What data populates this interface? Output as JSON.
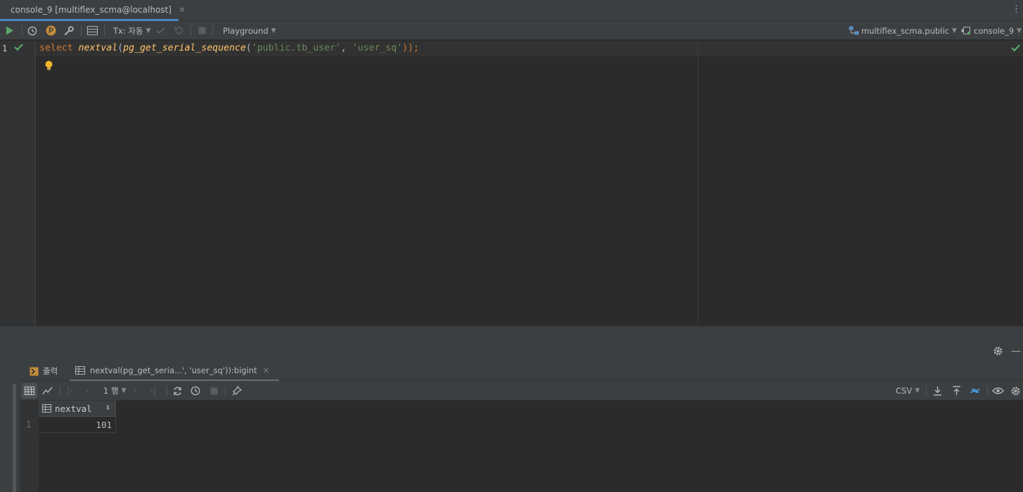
{
  "tab": {
    "title": "console_9 [multiflex_scma@localhost]"
  },
  "toolbar": {
    "tx_label": "Tx: 자동",
    "playground_label": "Playground",
    "schema_label": "multiflex_scma.public",
    "session_label": "console_9"
  },
  "editor": {
    "line_number": "1",
    "code": {
      "keyword": "select",
      "space": " ",
      "func1": "nextval",
      "paren_open": "(",
      "func2": "pg_get_serial_sequence",
      "paren_open2": "(",
      "arg1": "'public.tb_user'",
      "comma": ", ",
      "arg2": "'user_sq'",
      "close": "));"
    }
  },
  "results": {
    "output_tab_label": "출력",
    "result_tab_label": "nextval(pg_get_seria...', 'user_sq')):bigint",
    "row_count_label": "1 행",
    "export_format": "CSV",
    "columns": [
      "nextval"
    ],
    "rows": [
      {
        "row_number": "1",
        "values": [
          "101"
        ]
      }
    ]
  },
  "colors": {
    "accent": "#4a88c7",
    "success": "#59a869",
    "keyword": "#cc7832",
    "function": "#ffc66d",
    "string": "#6a8759",
    "bulb": "#f0b429"
  },
  "icons": [
    "postgres-icon",
    "run-icon",
    "history-icon",
    "p-icon",
    "wrench-icon",
    "table-icon",
    "commit-check-icon",
    "rollback-icon",
    "stop-icon",
    "schema-icon",
    "session-icon",
    "check-icon",
    "bulb-icon",
    "gear-icon",
    "minimize-icon",
    "grid-icon",
    "chart-icon",
    "first-page-icon",
    "prev-page-icon",
    "next-page-icon",
    "last-page-icon",
    "refresh-icon",
    "history-icon",
    "stop-icon",
    "pin-icon",
    "download-icon",
    "upload-icon",
    "compare-icon",
    "eye-icon"
  ]
}
